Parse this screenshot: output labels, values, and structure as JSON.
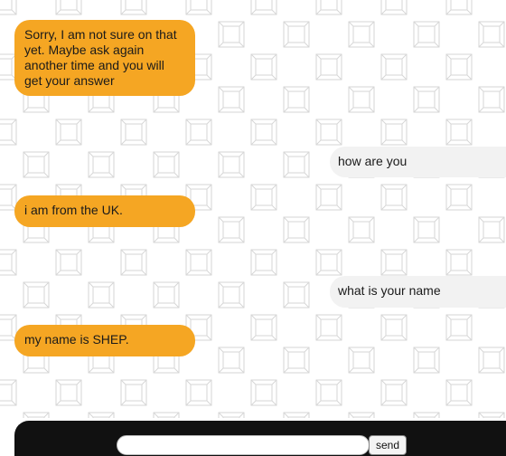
{
  "messages": [
    {
      "sender": "bot",
      "text": "Sorry, I am not sure on that yet. Maybe ask again another time and you will get your answer"
    },
    {
      "sender": "user",
      "text": "how are you"
    },
    {
      "sender": "bot",
      "text": "i am from the UK."
    },
    {
      "sender": "user",
      "text": "what is your name"
    },
    {
      "sender": "bot",
      "text": "my name is SHEP."
    }
  ],
  "composer": {
    "input_value": "",
    "input_placeholder": "",
    "send_label": "send"
  },
  "colors": {
    "bot_bubble": "#f5a623",
    "user_bubble": "#f2f2f2",
    "input_bar": "#111111"
  }
}
